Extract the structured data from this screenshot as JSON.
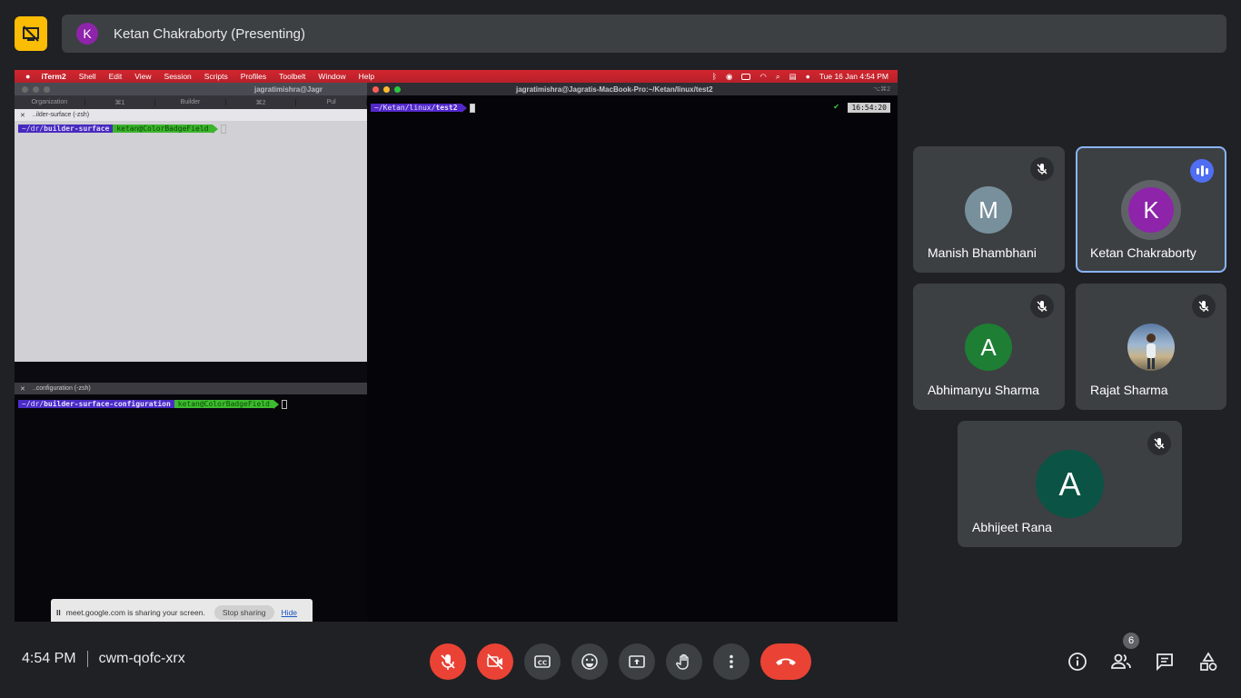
{
  "presenter": {
    "initial": "K",
    "name": "Ketan Chakraborty (Presenting)"
  },
  "screen": {
    "menubar": {
      "items": [
        "iTerm2",
        "Shell",
        "Edit",
        "View",
        "Session",
        "Scripts",
        "Profiles",
        "Toolbelt",
        "Window",
        "Help"
      ],
      "datetime": "Tue 16 Jan  4:54 PM"
    },
    "left_terminal": {
      "title": "jagratimishra@Jagr",
      "tabs": [
        "Organization",
        "⌘1",
        "Builder",
        "⌘2",
        "Pul"
      ],
      "top_pane": {
        "header": "..ilder-surface (-zsh)",
        "dir_prefix": "~/dr/",
        "dir": "builder-surface",
        "branch": "ketan@ColorBadgeField"
      },
      "bottom_pane": {
        "header": "..configuration (-zsh)",
        "dir_prefix": "~/dr/",
        "dir": "builder-surface-configuration",
        "branch": "ketan@ColorBadgeField"
      }
    },
    "right_terminal": {
      "title": "jagratimishra@Jagratis-MacBook-Pro:~/Ketan/linux/test2",
      "shortcut": "⌥⌘2",
      "prompt_prefix": "~/Ketan/linux/",
      "prompt_dir": "test2",
      "check": "✔",
      "clock": "16:54:20"
    },
    "share_notice": {
      "pause": "II",
      "text": "meet.google.com is sharing your screen.",
      "stop": "Stop sharing",
      "hide": "Hide"
    }
  },
  "participants": [
    {
      "initial": "M",
      "name": "Manish Bhambhani",
      "color": "#78909c",
      "muted": true
    },
    {
      "initial": "K",
      "name": "Ketan Chakraborty",
      "color": "#8e24aa",
      "muted": false,
      "speaking": true
    },
    {
      "initial": "A",
      "name": "Abhimanyu Sharma",
      "color": "#1e7e34",
      "muted": true
    },
    {
      "initial": "",
      "name": "Rajat Sharma",
      "color": "#5b7aa3",
      "muted": true
    },
    {
      "initial": "A",
      "name": "Abhijeet Rana",
      "color": "#0b5345",
      "muted": true
    }
  ],
  "meeting": {
    "time": "4:54 PM",
    "code": "cwm-qofc-xrx"
  },
  "people_count": "6",
  "colors": {
    "accent_blue": "#8ab4f8",
    "hangup_red": "#ea4335",
    "tile_bg": "#3c4043",
    "bg": "#202124"
  }
}
